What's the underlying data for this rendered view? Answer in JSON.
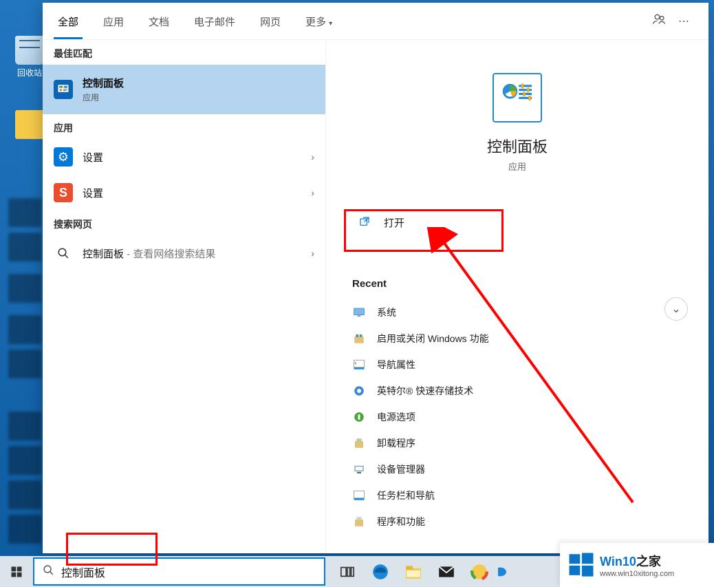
{
  "desktop": {
    "recycle_bin_label": "回收站"
  },
  "tabs": {
    "items": [
      "全部",
      "应用",
      "文档",
      "电子邮件",
      "网页"
    ],
    "more_label": "更多"
  },
  "left": {
    "best_match_header": "最佳匹配",
    "best_match": {
      "title": "控制面板",
      "subtitle": "应用"
    },
    "apps_header": "应用",
    "apps": [
      {
        "title": "设置"
      },
      {
        "title": "设置"
      }
    ],
    "web_header": "搜索网页",
    "web": {
      "title": "控制面板",
      "suffix": " - 查看网络搜索结果"
    }
  },
  "right": {
    "hero_title": "控制面板",
    "hero_sub": "应用",
    "open_label": "打开",
    "recent_header": "Recent",
    "recent": [
      "系统",
      "启用或关闭 Windows 功能",
      "导航属性",
      "英特尔® 快速存储技术",
      "电源选项",
      "卸载程序",
      "设备管理器",
      "任务栏和导航",
      "程序和功能"
    ]
  },
  "search": {
    "value": "控制面板"
  },
  "watermark": {
    "brand_a": "Win10",
    "brand_b": "之家",
    "url": "www.win10xitong.com"
  }
}
